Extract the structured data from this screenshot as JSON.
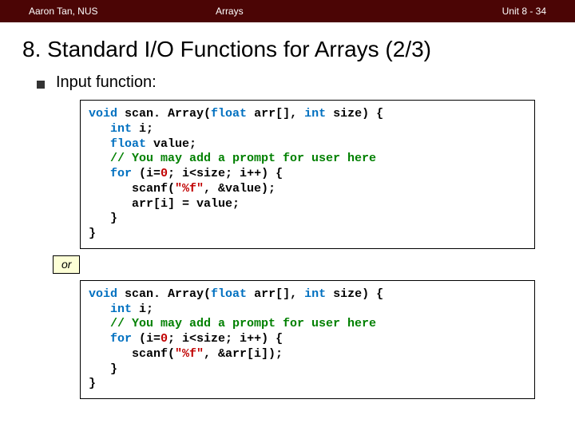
{
  "header": {
    "author": "Aaron Tan, NUS",
    "topic": "Arrays",
    "pager": "Unit 8 - 34"
  },
  "title": "8. Standard I/O Functions for Arrays (2/3)",
  "bullet": "Input function:",
  "or_label": "or",
  "code1": {
    "sig_pre": "void",
    "sig_fn": " scan. Array(",
    "sig_t1": "float",
    "sig_a1": " arr[], ",
    "sig_t2": "int",
    "sig_a2": " size) {",
    "l2a": "   int",
    "l2b": " i;",
    "l3a": "   float",
    "l3b": " value;",
    "l4": "   // You may add a prompt for user here",
    "l5a": "   for",
    "l5b": " (i=",
    "l5c": "0",
    "l5d": "; i<size; i++) {",
    "l6a": "      scanf(",
    "l6b": "\"%f\"",
    "l6c": ", &value);",
    "l7": "      arr[i] = value;",
    "l8": "   }",
    "l9": "}"
  },
  "code2": {
    "sig_pre": "void",
    "sig_fn": " scan. Array(",
    "sig_t1": "float",
    "sig_a1": " arr[], ",
    "sig_t2": "int",
    "sig_a2": " size) {",
    "l2a": "   int",
    "l2b": " i;",
    "l3": "   // You may add a prompt for user here",
    "l4a": "   for",
    "l4b": " (i=",
    "l4c": "0",
    "l4d": "; i<size; i++) {",
    "l5a": "      scanf(",
    "l5b": "\"%f\"",
    "l5c": ", &arr[i]);",
    "l6": "   }",
    "l7": "}"
  }
}
